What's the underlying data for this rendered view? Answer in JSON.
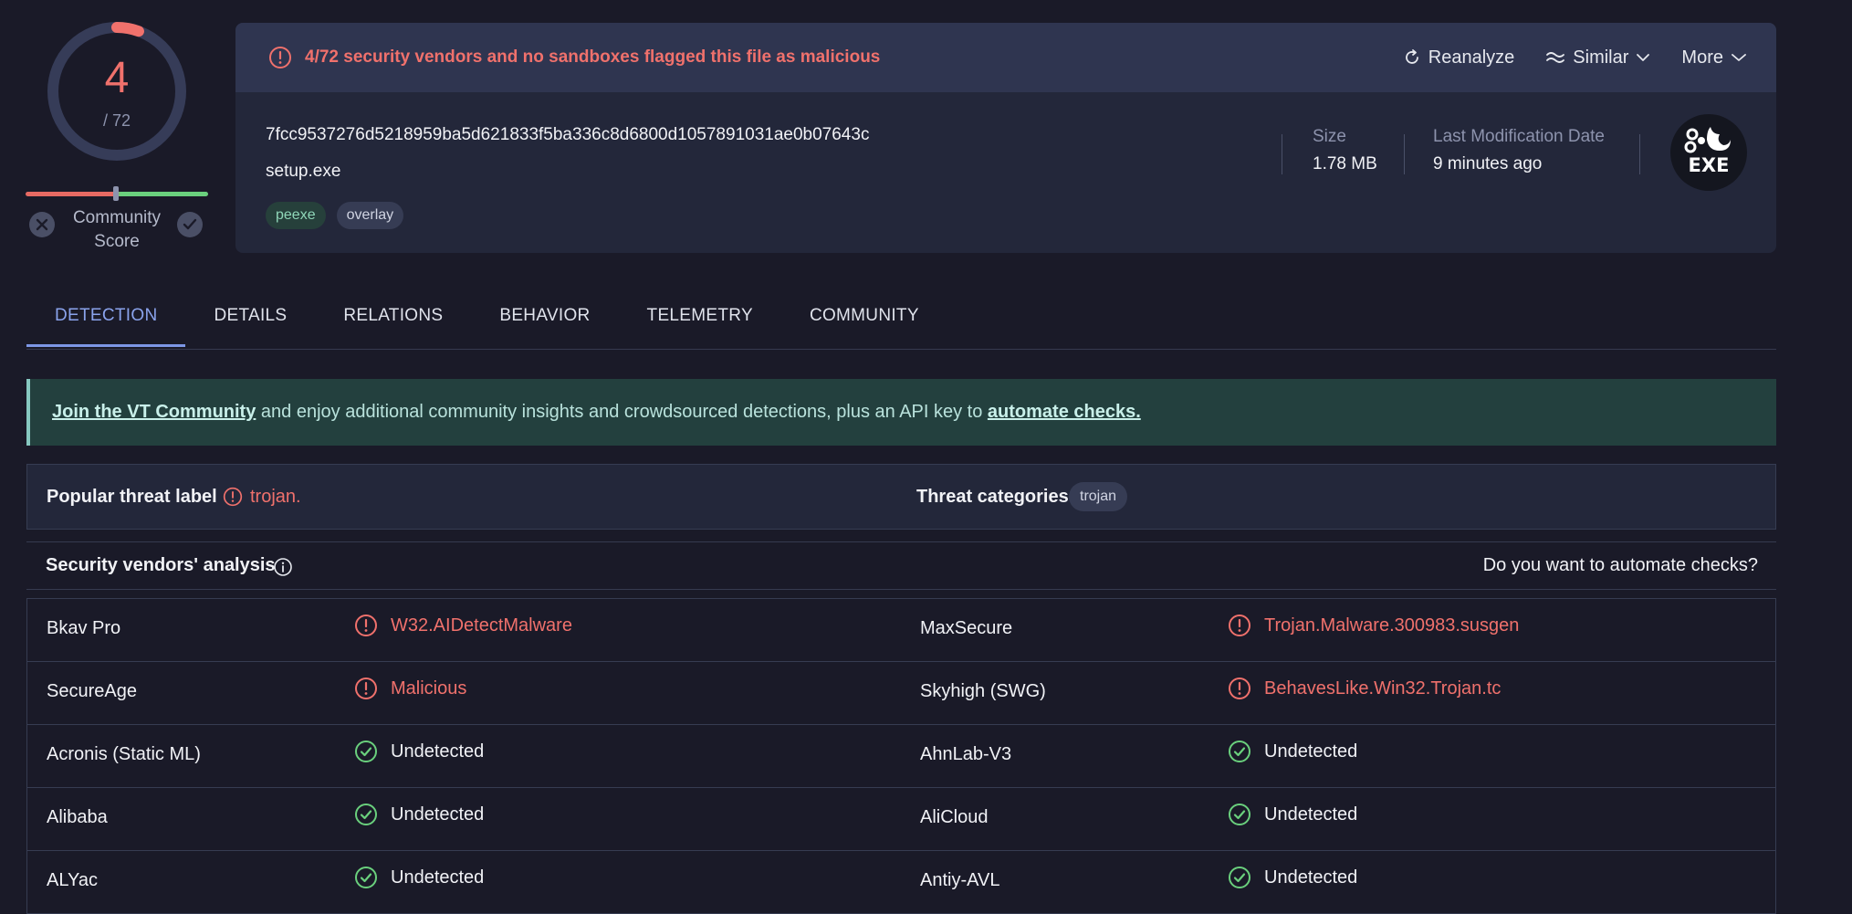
{
  "score": {
    "detections": "4",
    "total": "/ 72",
    "community_label_1": "Community",
    "community_label_2": "Score",
    "detection_ratio": 0.0556
  },
  "banner": {
    "message": "4/72 security vendors and no sandboxes flagged this file as malicious",
    "actions": {
      "reanalyze": "Reanalyze",
      "similar": "Similar",
      "more": "More"
    }
  },
  "file": {
    "hash": "7fcc9537276d5218959ba5d621833f5ba336c8d6800d1057891031ae0b07643c",
    "name": "setup.exe",
    "tags": [
      "peexe",
      "overlay"
    ],
    "size_label": "Size",
    "size_value": "1.78 MB",
    "date_label": "Last Modification Date",
    "date_value": "9 minutes ago",
    "type_icon_text": "EXE"
  },
  "tabs": [
    "DETECTION",
    "DETAILS",
    "RELATIONS",
    "BEHAVIOR",
    "TELEMETRY",
    "COMMUNITY"
  ],
  "community": {
    "join_link": "Join the VT Community",
    "mid_text": " and enjoy additional community insights and crowdsourced detections, plus an API key to ",
    "automate_link": "automate checks."
  },
  "threat": {
    "popular_label": "Popular threat label",
    "popular_value": "trojan.",
    "categories_label": "Threat categories",
    "category": "trojan"
  },
  "vendors": {
    "title": "Security vendors' analysis",
    "automate": "Do you want to automate checks?",
    "rows": [
      {
        "v1": "Bkav Pro",
        "r1": "W32.AIDetectMalware",
        "s1": "bad",
        "v2": "MaxSecure",
        "r2": "Trojan.Malware.300983.susgen",
        "s2": "bad"
      },
      {
        "v1": "SecureAge",
        "r1": "Malicious",
        "s1": "bad",
        "v2": "Skyhigh (SWG)",
        "r2": "BehavesLike.Win32.Trojan.tc",
        "s2": "bad"
      },
      {
        "v1": "Acronis (Static ML)",
        "r1": "Undetected",
        "s1": "ok",
        "v2": "AhnLab-V3",
        "r2": "Undetected",
        "s2": "ok"
      },
      {
        "v1": "Alibaba",
        "r1": "Undetected",
        "s1": "ok",
        "v2": "AliCloud",
        "r2": "Undetected",
        "s2": "ok"
      },
      {
        "v1": "ALYac",
        "r1": "Undetected",
        "s1": "ok",
        "v2": "Antiy-AVL",
        "r2": "Undetected",
        "s2": "ok"
      }
    ]
  },
  "colors": {
    "danger": "#f0716c",
    "success": "#6ad07d",
    "accent": "#8aa3ec",
    "background": "#1a1a28"
  }
}
